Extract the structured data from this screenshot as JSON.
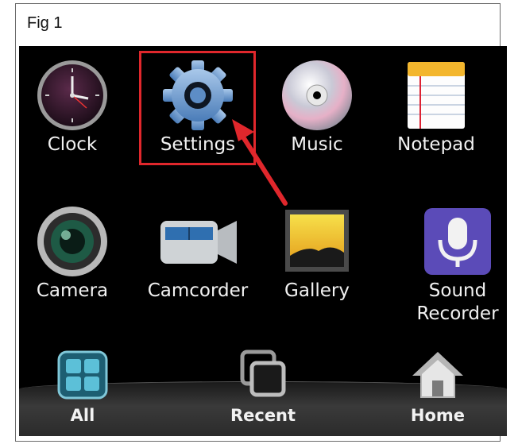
{
  "figure": {
    "label": "Fig 1"
  },
  "apps": [
    {
      "label": "Clock",
      "icon": "clock-icon"
    },
    {
      "label": "Settings",
      "icon": "gear-icon"
    },
    {
      "label": "Music",
      "icon": "music-disc-icon"
    },
    {
      "label": "Notepad",
      "icon": "notepad-icon"
    },
    {
      "label": "Camera",
      "icon": "camera-icon"
    },
    {
      "label": "Camcorder",
      "icon": "camcorder-icon"
    },
    {
      "label": "Gallery",
      "icon": "gallery-icon"
    },
    {
      "label": "Sound Recorder",
      "icon": "microphone-icon"
    }
  ],
  "dock": [
    {
      "label": "All",
      "icon": "grid-icon"
    },
    {
      "label": "Recent",
      "icon": "recent-icon"
    },
    {
      "label": "Home",
      "icon": "home-icon"
    }
  ],
  "annotation": {
    "highlight_color": "#e0272c",
    "target": "Settings"
  }
}
